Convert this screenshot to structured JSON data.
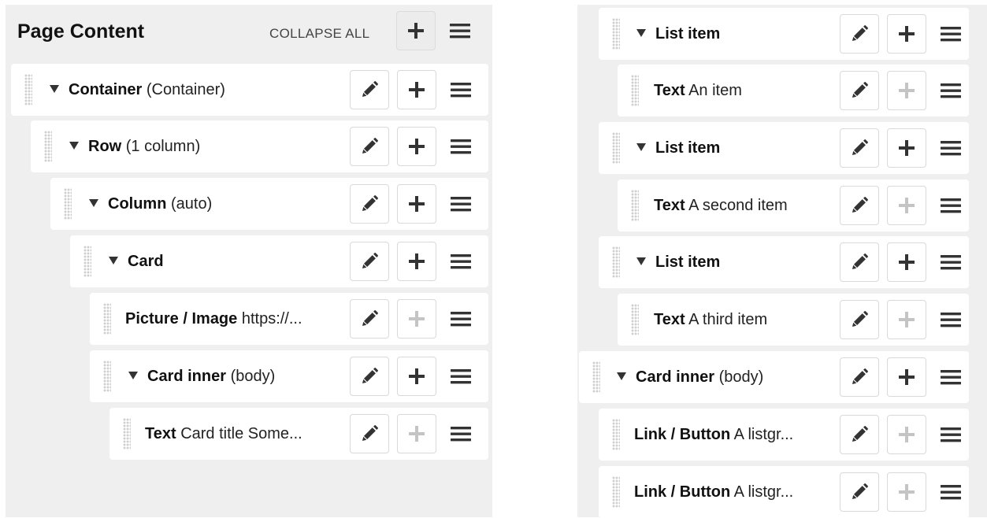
{
  "header": {
    "title": "Page Content",
    "collapse_all": "COLLAPSE ALL"
  },
  "left_tree": [
    {
      "name": "Container",
      "detail": "(Container)",
      "expandable": true,
      "add_enabled": true
    },
    {
      "name": "Row",
      "detail": "(1 column)",
      "expandable": true,
      "add_enabled": true
    },
    {
      "name": "Column",
      "detail": "(auto)",
      "expandable": true,
      "add_enabled": true
    },
    {
      "name": "Card",
      "detail": "",
      "expandable": true,
      "add_enabled": true
    },
    {
      "name": "Picture / Image",
      "detail": "https://...",
      "expandable": false,
      "add_enabled": false
    },
    {
      "name": "Card inner",
      "detail": "(body)",
      "expandable": true,
      "add_enabled": true
    },
    {
      "name": "Text",
      "detail": "Card title Some...",
      "expandable": false,
      "add_enabled": false
    }
  ],
  "right_tree": [
    {
      "name": "List item",
      "detail": "",
      "expandable": true,
      "add_enabled": true
    },
    {
      "name": "Text",
      "detail": "An item",
      "expandable": false,
      "add_enabled": false
    },
    {
      "name": "List item",
      "detail": "",
      "expandable": true,
      "add_enabled": true
    },
    {
      "name": "Text",
      "detail": "A second item",
      "expandable": false,
      "add_enabled": false
    },
    {
      "name": "List item",
      "detail": "",
      "expandable": true,
      "add_enabled": true
    },
    {
      "name": "Text",
      "detail": "A third item",
      "expandable": false,
      "add_enabled": false
    },
    {
      "name": "Card inner",
      "detail": "(body)",
      "expandable": true,
      "add_enabled": true
    },
    {
      "name": "Link / Button",
      "detail": "A listgr...",
      "expandable": false,
      "add_enabled": false
    },
    {
      "name": "Link / Button",
      "detail": "A listgr...",
      "expandable": false,
      "add_enabled": false
    }
  ],
  "icons": {
    "edit": "pencil-icon",
    "add": "plus-icon",
    "menu": "hamburger-menu-icon",
    "drag": "drag-handle-icon",
    "expand": "caret-down-icon"
  },
  "colors": {
    "panel_bg": "#efefef",
    "row_bg": "#ffffff",
    "icon": "#333333",
    "icon_disabled": "#c4c4c4"
  }
}
